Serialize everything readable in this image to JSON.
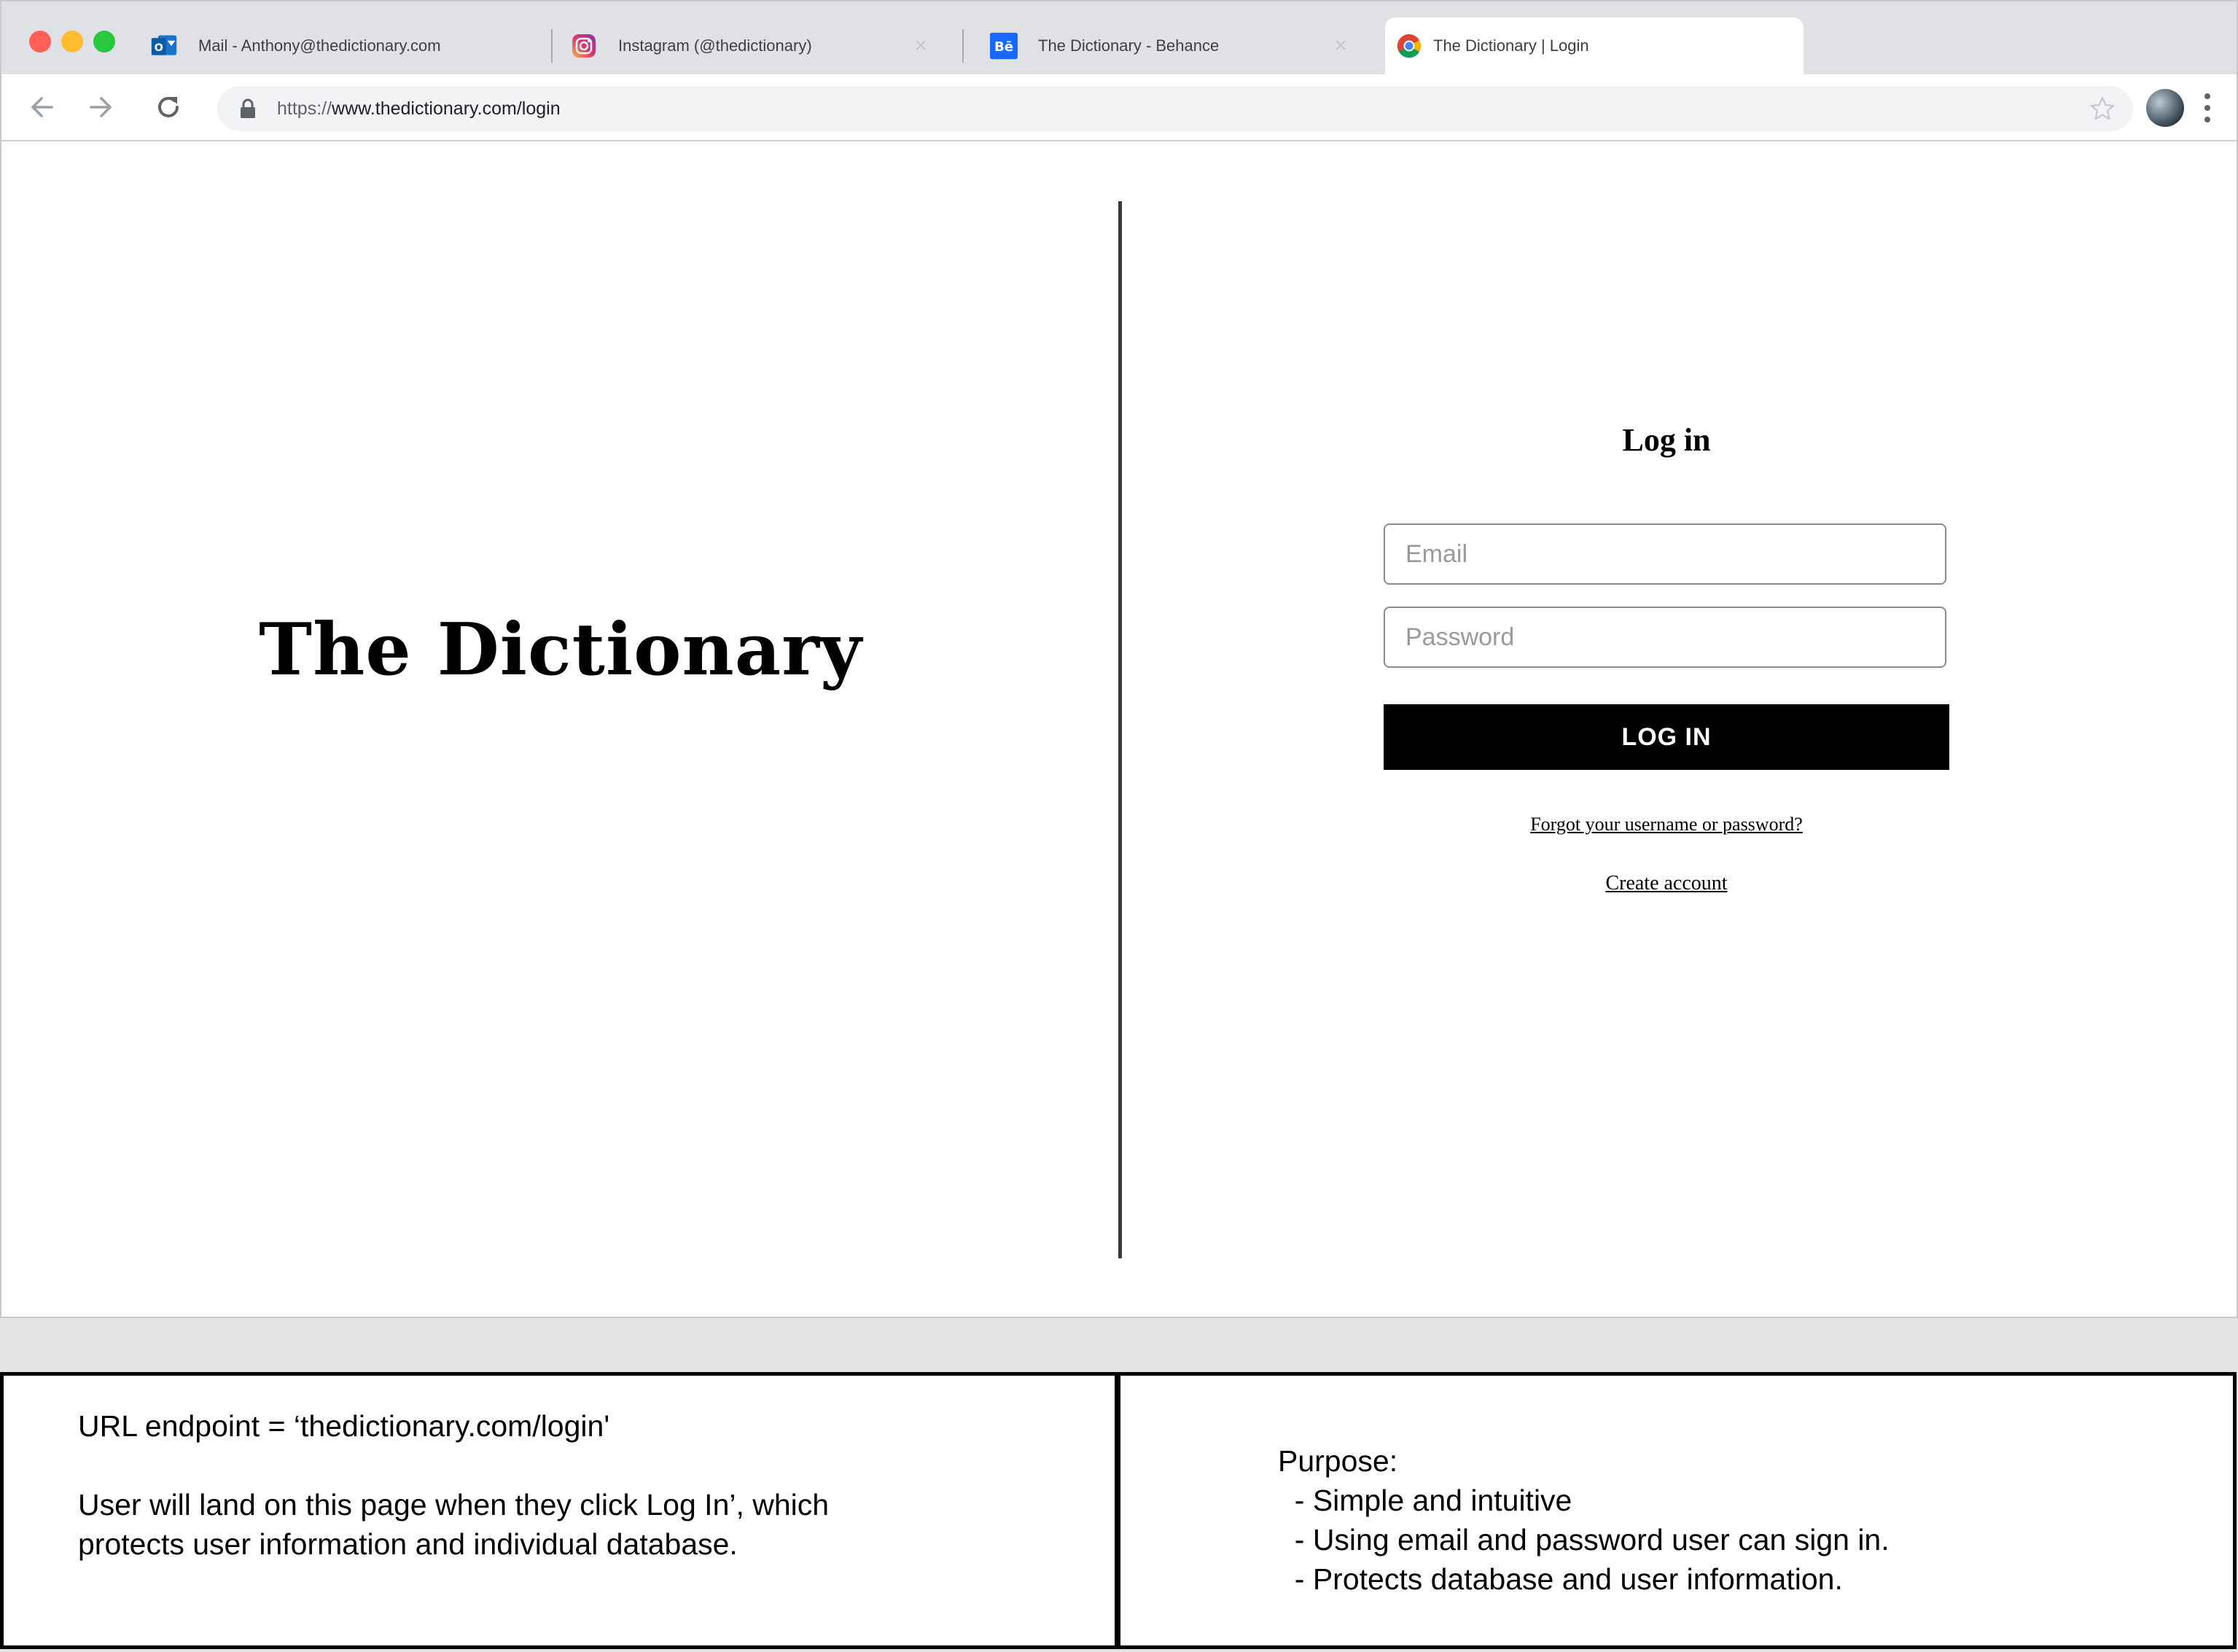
{
  "browser": {
    "tabs": [
      {
        "title": "Mail - Anthony@thedictionary.com",
        "icon": "outlook-icon"
      },
      {
        "title": "Instagram (@thedictionary)",
        "icon": "instagram-icon"
      },
      {
        "title": "The Dictionary - Behance",
        "icon": "behance-icon"
      },
      {
        "title": "The Dictionary | Login",
        "icon": "chrome-icon"
      }
    ],
    "url_scheme": "https://",
    "url_rest": "www.thedictionary.com/login"
  },
  "page": {
    "brand": "The Dictionary",
    "login_title": "Log in",
    "email_placeholder": "Email",
    "password_placeholder": "Password",
    "login_button": "LOG IN",
    "forgot_link": "Forgot your username or password?",
    "create_link": "Create account"
  },
  "notes": {
    "left": {
      "endpoint": "URL endpoint = ‘thedictionary.com/login'",
      "description": "User will land on this page when they click Log In’, which\nprotects user information and individual database."
    },
    "right": {
      "heading": "Purpose:",
      "items": [
        "  - Simple and intuitive",
        "  - Using email and password user can sign in.",
        "  - Protects database and user information."
      ]
    }
  },
  "colors": {
    "tabstrip": "#dfe1e5",
    "close_red": "#ff5f57",
    "minimize_yellow": "#febc2e",
    "zoom_green": "#28c840",
    "button_black": "#000000"
  }
}
